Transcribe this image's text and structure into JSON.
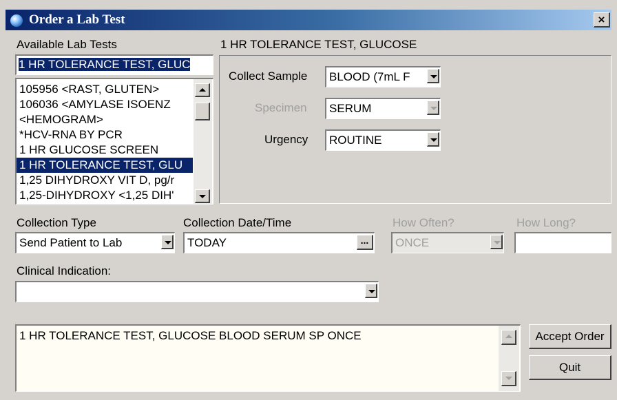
{
  "window": {
    "title": "Order a Lab Test",
    "close_glyph": "×"
  },
  "available": {
    "label": "Available Lab Tests",
    "search_value": "1 HR TOLERANCE TEST, GLUC",
    "items": [
      "105956   <RAST, GLUTEN>",
      "106036   <AMYLASE ISOENZ",
      "                <HEMOGRAM>",
      "*HCV-RNA BY PCR",
      "1 HR GLUCOSE SCREEN",
      "1 HR TOLERANCE TEST, GLU",
      "1,25 DIHYDROXY VIT D, pg/r",
      "1,25-DIHYDROXY  <1,25 DIH'"
    ]
  },
  "test": {
    "heading": "1 HR TOLERANCE TEST, GLUCOSE",
    "collect_sample_label": "Collect Sample",
    "collect_sample_value": "BLOOD   (7mL F",
    "specimen_label": "Specimen",
    "specimen_value": "SERUM",
    "urgency_label": "Urgency",
    "urgency_value": "ROUTINE"
  },
  "collection": {
    "type_label": "Collection Type",
    "type_value": "Send Patient to Lab",
    "datetime_label": "Collection Date/Time",
    "datetime_value": "TODAY",
    "ellipsis_label": "...",
    "how_often_label": "How Often?",
    "how_often_value": "ONCE",
    "how_long_label": "How Long?",
    "how_long_value": ""
  },
  "clinical": {
    "label": "Clinical Indication:",
    "value": ""
  },
  "order": {
    "summary": "1 HR TOLERANCE TEST, GLUCOSE BLOOD   SERUM  SP ONCE",
    "accept_label": "Accept Order",
    "quit_label": "Quit"
  },
  "colors": {
    "titlebar": "#0a246a",
    "selection": "#0a246a",
    "face": "#d6d3ce",
    "memo": "#fffdf4"
  }
}
